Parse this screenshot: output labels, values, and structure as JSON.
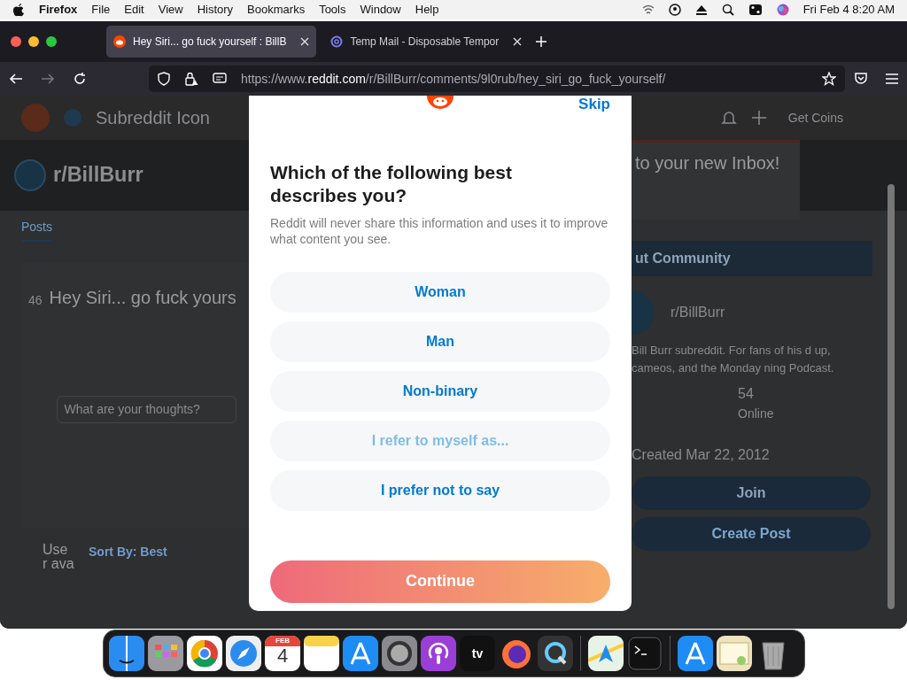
{
  "menubar": {
    "app": "Firefox",
    "menus": [
      "File",
      "Edit",
      "View",
      "History",
      "Bookmarks",
      "Tools",
      "Window",
      "Help"
    ],
    "clock": "Fri Feb 4  8:20 AM"
  },
  "tabs": [
    {
      "title": "Hey Siri... go fuck yourself : BillB",
      "selected": true
    },
    {
      "title": "Temp Mail - Disposable Tempor",
      "selected": false
    }
  ],
  "address_bar": {
    "url": "https://www.**reddit.com**/r/BillBurr/comments/9l0rub/hey_siri_go_fuck_yourself/"
  },
  "page": {
    "header_text": "Subreddit Icon",
    "header_right": "Get Coins",
    "banner_title": "r/BillBurr",
    "nav_tab": "Posts",
    "post": {
      "votes": "46",
      "title": "Hey Siri... go fuck yours",
      "comment_placeholder": "What are your thoughts?",
      "sort": "Sort By: Best",
      "avatar_text": "Use r ava"
    },
    "inbox_title": "to your new Inbox!",
    "community": {
      "heading": "ut Community",
      "name": "r/BillBurr",
      "description": "Bill Burr subreddit. For fans of his d up, cameos, and the Monday ning Podcast.",
      "online_count": "54",
      "online_label": "Online",
      "created": "Created Mar 22, 2012",
      "join": "Join",
      "create_post": "Create Post"
    }
  },
  "modal": {
    "skip": "Skip",
    "question": "Which of the following best describes you?",
    "note": "Reddit will never share this information and uses it to improve what content you see.",
    "options": [
      {
        "kind": "choice",
        "label": "Woman"
      },
      {
        "kind": "choice",
        "label": "Man"
      },
      {
        "kind": "choice",
        "label": "Non-binary"
      },
      {
        "kind": "input",
        "placeholder": "I refer to myself as..."
      },
      {
        "kind": "choice",
        "label": "I prefer not to say"
      }
    ],
    "continue": "Continue"
  },
  "dock": {
    "calendar_month": "FEB",
    "calendar_day": "4",
    "tv_label": "tv"
  }
}
